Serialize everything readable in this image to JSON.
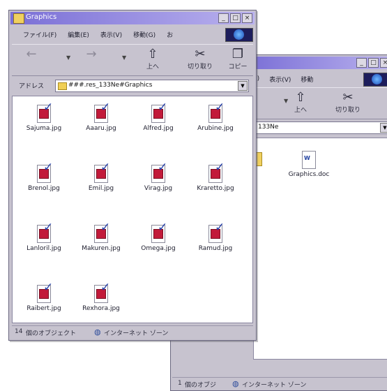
{
  "front_window": {
    "title": "Graphics",
    "title_buttons": [
      "_",
      "□",
      "×"
    ],
    "menu": [
      "ファイル(F)",
      "編集(E)",
      "表示(V)",
      "移動(G)",
      "お"
    ],
    "toolbar": [
      "",
      "",
      "上へ",
      "切り取り",
      "コピー"
    ],
    "address_label": "アドレス",
    "address_value": "###.res_133Ne#Graphics",
    "files": [
      "Sajuma.jpg",
      "Aaaru.jpg",
      "Alfred.jpg",
      "Arubine.jpg",
      "Brenol.jpg",
      "Emil.jpg",
      "Virag.jpg",
      "Kraretto.jpg",
      "Lanloril.jpg",
      "Makuren.jpg",
      "Omega.jpg",
      "Ramud.jpg",
      "Raibert.jpg",
      "Rexhora.jpg"
    ],
    "status_count": "14",
    "status_text": "個のオブジェクト",
    "status_zone": "インターネット ゾーン"
  },
  "back_window": {
    "title_buttons": [
      "_",
      "□",
      "×"
    ],
    "menu": [
      "E)",
      "表示(V)",
      "移動"
    ],
    "toolbar": [
      "上へ",
      "切り取り"
    ],
    "address_value": "133Ne",
    "files": [
      "",
      "Graphics.doc"
    ],
    "status_count": "1",
    "status_text": "個のオブジ",
    "status_zone": "インターネット ゾーン"
  },
  "colors": {
    "title_gradient_start": "#7a6fd6",
    "title_gradient_end": "#b9b1ee",
    "window_face": "#c7c3cf",
    "file_pic": "#c21a3a",
    "checkmark": "#2540a8"
  }
}
